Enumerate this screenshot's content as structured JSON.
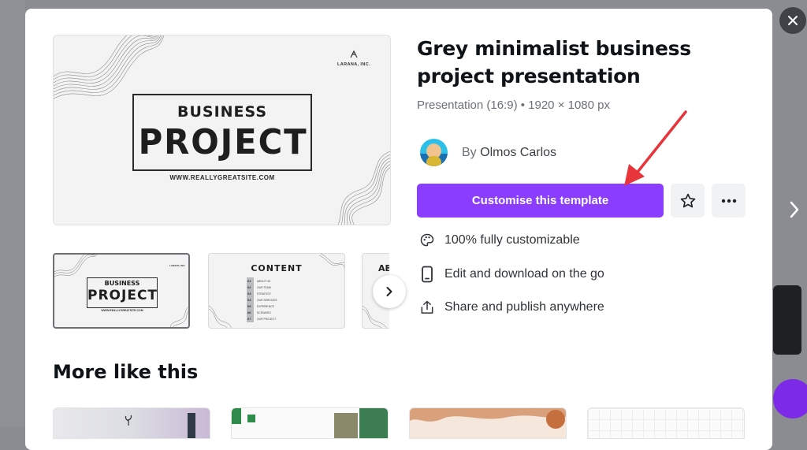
{
  "template": {
    "title": "Grey minimalist business project presentation",
    "meta": "Presentation (16:9) • 1920 × 1080 px",
    "author_prefix": "By",
    "author_name": "Olmos Carlos",
    "cta_label": "Customise this template"
  },
  "preview": {
    "small_title": "BUSINESS",
    "big_title": "PROJECT",
    "url": "WWW.REALLYGREATSITE.COM",
    "company": "LARANA, INC."
  },
  "thumbnails": [
    {
      "small_title": "BUSINESS",
      "big_title": "PROJECT",
      "url": "WWW.REALLYGREATSITE.COM",
      "company": "LARANA, INC."
    },
    {
      "title": "CONTENT",
      "numbers": [
        "01",
        "02",
        "03",
        "04",
        "05",
        "06",
        "07"
      ],
      "items": [
        "ABOUT US",
        "OUR TEAM",
        "STRATEGY",
        "OUR SERVICES",
        "EXPERIENCE",
        "SCENARIO",
        "OUR PROJECT"
      ]
    },
    {
      "title": "AB"
    }
  ],
  "features": [
    {
      "icon": "palette-icon",
      "label": "100% fully customizable"
    },
    {
      "icon": "phone-icon",
      "label": "Edit and download on the go"
    },
    {
      "icon": "share-icon",
      "label": "Share and publish anywhere"
    }
  ],
  "more_like_this": "More like this",
  "colors": {
    "accent": "#8b3dff",
    "annotation_arrow": "#e8343b",
    "overlay": "#8a8c91"
  }
}
